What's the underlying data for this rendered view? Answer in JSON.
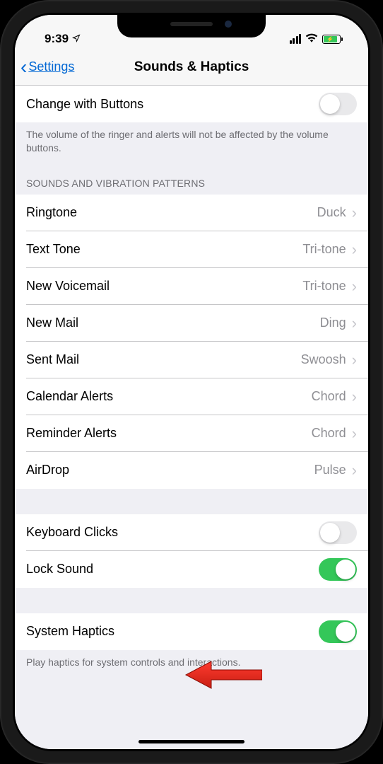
{
  "status": {
    "time": "9:39"
  },
  "nav": {
    "back_label": "Settings",
    "title": "Sounds & Haptics"
  },
  "change_buttons": {
    "label": "Change with Buttons",
    "on": false,
    "footer": "The volume of the ringer and alerts will not be affected by the volume buttons."
  },
  "patterns": {
    "header": "SOUNDS AND VIBRATION PATTERNS",
    "items": [
      {
        "label": "Ringtone",
        "value": "Duck"
      },
      {
        "label": "Text Tone",
        "value": "Tri-tone"
      },
      {
        "label": "New Voicemail",
        "value": "Tri-tone"
      },
      {
        "label": "New Mail",
        "value": "Ding"
      },
      {
        "label": "Sent Mail",
        "value": "Swoosh"
      },
      {
        "label": "Calendar Alerts",
        "value": "Chord"
      },
      {
        "label": "Reminder Alerts",
        "value": "Chord"
      },
      {
        "label": "AirDrop",
        "value": "Pulse"
      }
    ]
  },
  "toggles_group": {
    "items": [
      {
        "label": "Keyboard Clicks",
        "on": false
      },
      {
        "label": "Lock Sound",
        "on": true
      }
    ]
  },
  "system_haptics": {
    "label": "System Haptics",
    "on": true,
    "footer": "Play haptics for system controls and interactions."
  }
}
